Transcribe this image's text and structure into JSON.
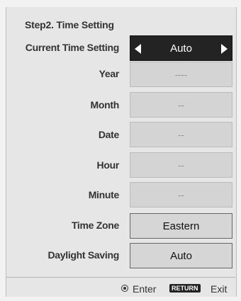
{
  "title": "Step2. Time Setting",
  "rows": [
    {
      "label": "Current Time Setting",
      "value": "Auto",
      "state": "selected"
    },
    {
      "label": "Year",
      "value": "----",
      "state": "disabled"
    },
    {
      "label": "Month",
      "value": "--",
      "state": "disabled"
    },
    {
      "label": "Date",
      "value": "--",
      "state": "disabled"
    },
    {
      "label": "Hour",
      "value": "--",
      "state": "disabled"
    },
    {
      "label": "Minute",
      "value": "--",
      "state": "disabled"
    },
    {
      "label": "Time Zone",
      "value": "Eastern",
      "state": "normal"
    },
    {
      "label": "Daylight Saving",
      "value": "Auto",
      "state": "normal"
    }
  ],
  "footer": {
    "enter_label": "Enter",
    "return_key": "RETURN",
    "exit_label": "Exit"
  },
  "icons": {
    "left": "left-arrow-icon",
    "right": "right-arrow-icon",
    "enter": "enter-button-icon"
  }
}
